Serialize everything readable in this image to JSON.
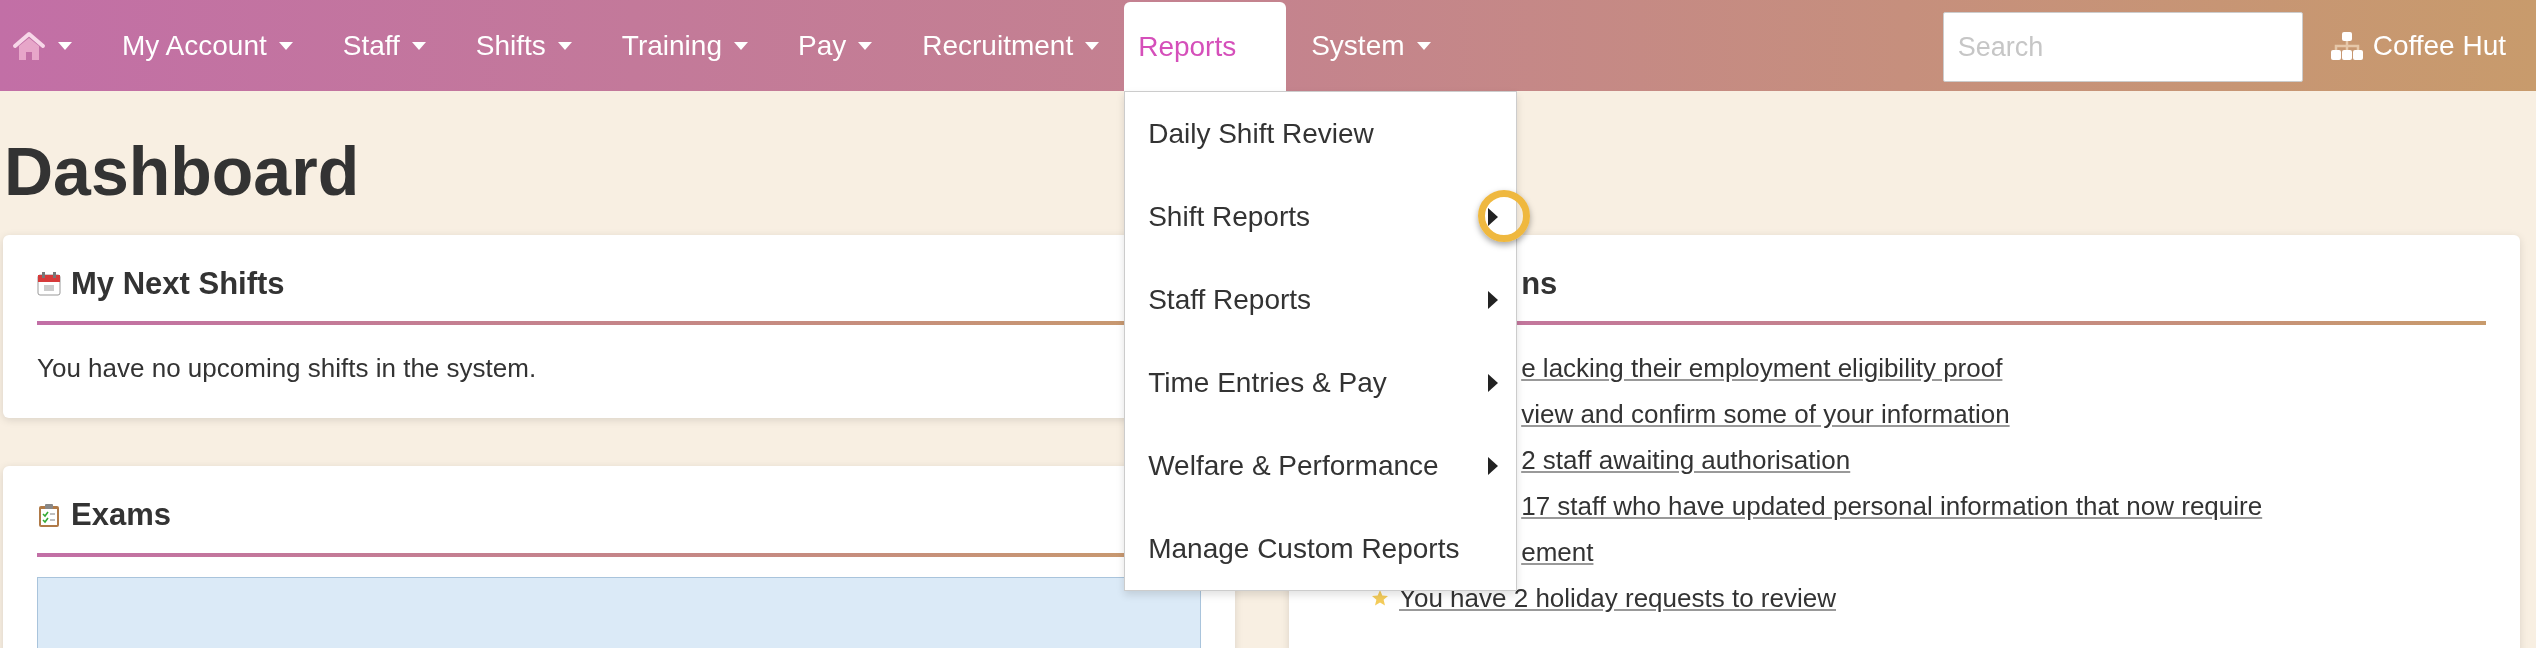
{
  "navbar": {
    "items": [
      {
        "kind": "home",
        "caret": true,
        "selected": false
      },
      {
        "kind": "text",
        "label": "My Account",
        "caret": true,
        "selected": false
      },
      {
        "kind": "text",
        "label": "Staff",
        "caret": true,
        "selected": false
      },
      {
        "kind": "text",
        "label": "Shifts",
        "caret": true,
        "selected": false
      },
      {
        "kind": "text",
        "label": "Training",
        "caret": true,
        "selected": false
      },
      {
        "kind": "text",
        "label": "Pay",
        "caret": true,
        "selected": false
      },
      {
        "kind": "text",
        "label": "Recruitment",
        "caret": true,
        "selected": false
      },
      {
        "kind": "text",
        "label": "Reports",
        "caret": false,
        "selected": true
      },
      {
        "kind": "text",
        "label": "System",
        "caret": true,
        "selected": false
      }
    ],
    "search": {
      "placeholder": "Search"
    },
    "organisation": "Coffee Hut"
  },
  "dropdown": {
    "items": [
      {
        "label": "Daily Shift Review",
        "submenu": false,
        "highlighted": false
      },
      {
        "label": "Shift Reports",
        "submenu": true,
        "highlighted": true
      },
      {
        "label": "Staff Reports",
        "submenu": true,
        "highlighted": false
      },
      {
        "label": "Time Entries & Pay",
        "submenu": true,
        "highlighted": false
      },
      {
        "label": "Welfare & Performance",
        "submenu": true,
        "highlighted": false
      },
      {
        "label": "Manage Custom Reports",
        "submenu": false,
        "highlighted": false
      }
    ]
  },
  "page_title": "Dashboard",
  "left_cards": [
    {
      "title": "My Next Shifts",
      "text": "You have no upcoming shifts in the system."
    },
    {
      "title": "Exams",
      "panel": true
    }
  ],
  "right_card": {
    "title": "ns",
    "items": [
      {
        "kind": "clipped",
        "text": "e lacking their employment eligibility proof"
      },
      {
        "kind": "clipped",
        "text": "view and confirm some of your information"
      },
      {
        "kind": "clipped",
        "text": "2 staff awaiting authorisation"
      },
      {
        "kind": "clipped",
        "text": "17 staff who have updated personal information that now require"
      },
      {
        "kind": "clipped",
        "text": "ement"
      },
      {
        "kind": "star",
        "text": "You have 2 holiday requests to review"
      }
    ]
  }
}
